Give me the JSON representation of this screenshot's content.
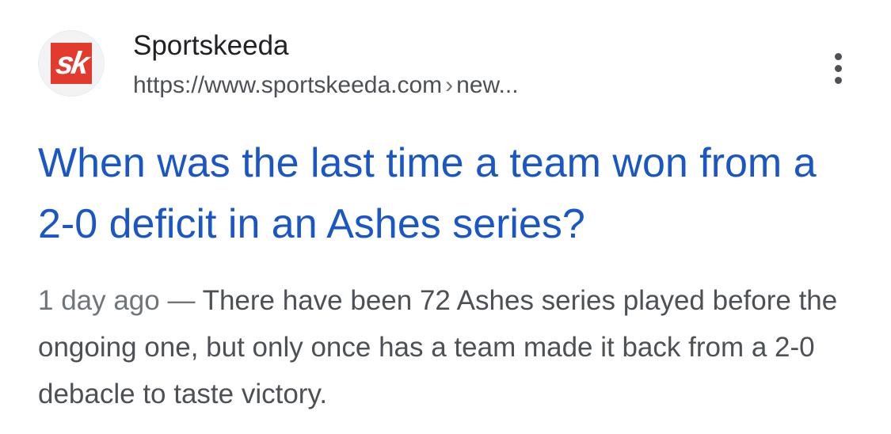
{
  "result": {
    "favicon": {
      "icon": "sportskeeda-logo-icon",
      "text": "sk",
      "bg_color": "#e23b2e"
    },
    "site_name": "Sportskeeda",
    "url": "https://www.sportskeeda.com",
    "url_separator": "›",
    "url_path": "new...",
    "more_icon": "more-vert-icon",
    "title": "When was the last time a team won from a 2-0 deficit in an Ashes series?",
    "snippet_date": "1 day ago",
    "snippet_dash": "—",
    "snippet_text": "There have been 72 Ashes series played before the ongoing one, but only once has a team made it back from a 2-0 debacle to taste victory."
  },
  "colors": {
    "title_link": "#1a56c6",
    "site_name": "#202124",
    "url": "#4d5156",
    "snippet": "#4d5156"
  }
}
